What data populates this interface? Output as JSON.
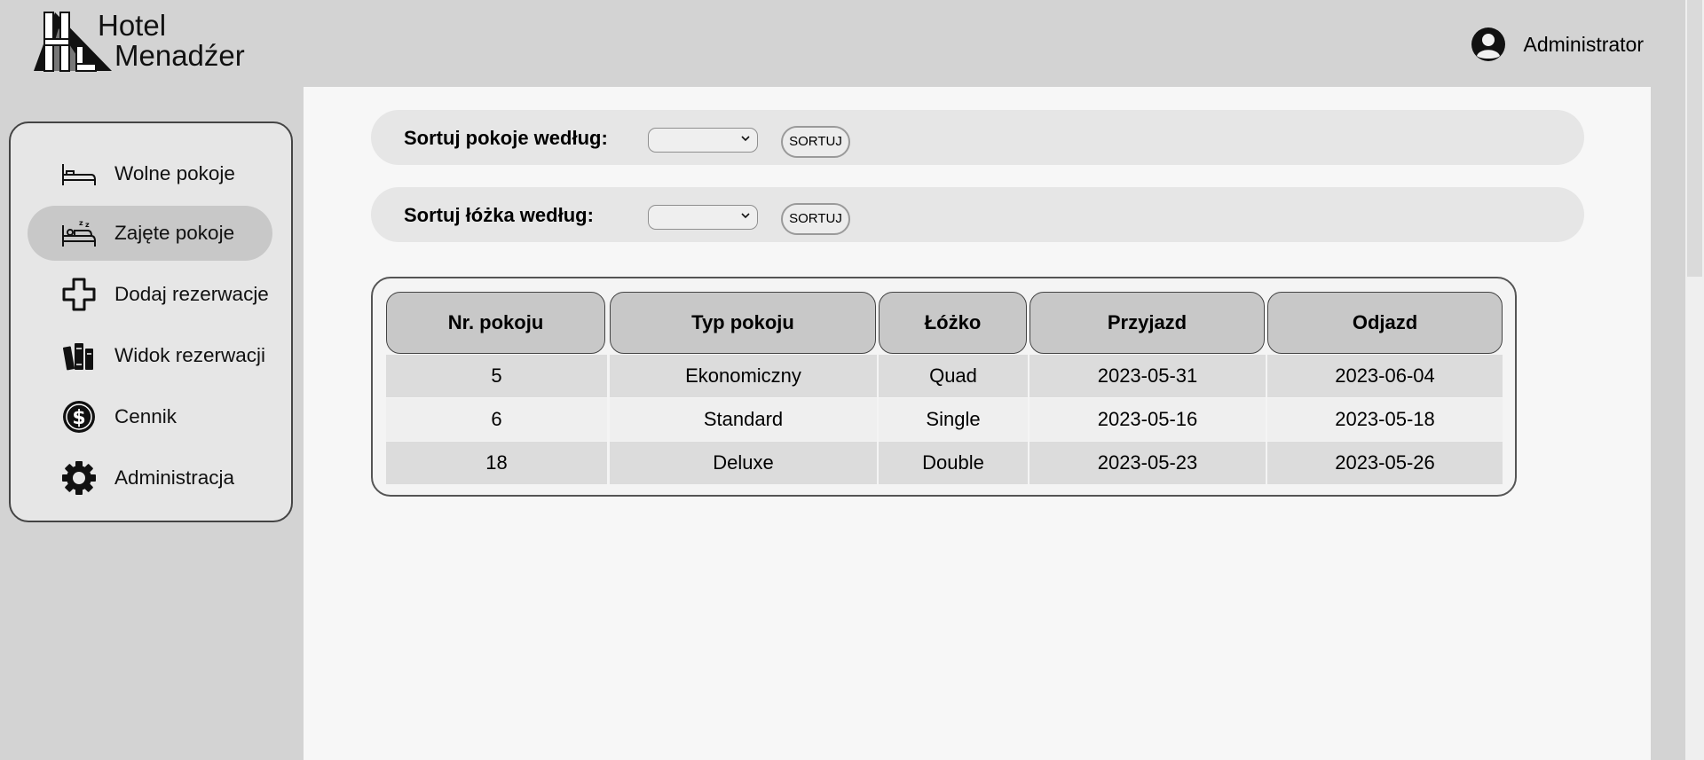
{
  "header": {
    "logo": {
      "line1": "Hotel",
      "line2": "Menadźer",
      "monogram": "HL"
    },
    "user": {
      "name": "Administrator",
      "icon": "user-circle-icon"
    }
  },
  "sidebar": {
    "items": [
      {
        "label": "Wolne pokoje",
        "icon": "bed-icon",
        "active": false
      },
      {
        "label": "Zajęte pokoje",
        "icon": "sleeping-bed-icon",
        "active": true
      },
      {
        "label": "Dodaj rezerwacje",
        "icon": "plus-icon",
        "active": false
      },
      {
        "label": "Widok rezerwacji",
        "icon": "books-icon",
        "active": false
      },
      {
        "label": "Cennik",
        "icon": "dollar-icon",
        "active": false
      },
      {
        "label": "Administracja",
        "icon": "gear-icon",
        "active": false
      }
    ]
  },
  "sort_rooms": {
    "label": "Sortuj pokoje według:",
    "selected": "",
    "button": "SORTUJ"
  },
  "sort_beds": {
    "label": "Sortuj łóżka według:",
    "selected": "",
    "button": "SORTUJ"
  },
  "table": {
    "headers": [
      "Nr. pokoju",
      "Typ pokoju",
      "Łóżko",
      "Przyjazd",
      "Odjazd"
    ],
    "rows": [
      [
        "5",
        "Ekonomiczny",
        "Quad",
        "2023-05-31",
        "2023-06-04"
      ],
      [
        "6",
        "Standard",
        "Single",
        "2023-05-16",
        "2023-05-18"
      ],
      [
        "18",
        "Deluxe",
        "Double",
        "2023-05-23",
        "2023-05-26"
      ]
    ]
  },
  "colors": {
    "page_bg": "#d3d3d3",
    "content_bg": "#f7f7f7",
    "active_nav": "#c8c8c8",
    "header_cell": "#c8c8c8"
  }
}
